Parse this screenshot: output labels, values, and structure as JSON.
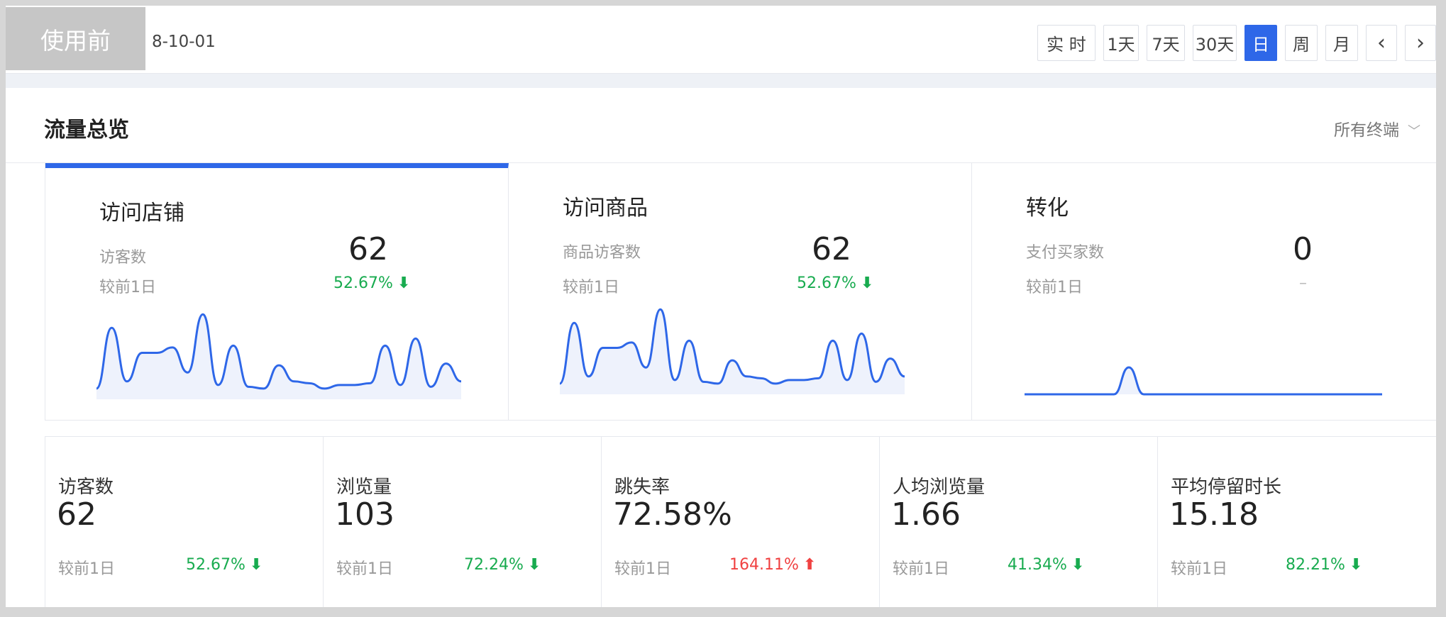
{
  "tag": "使用前",
  "date_text": "8-10-01",
  "range_buttons": [
    "实 时",
    "1天",
    "7天",
    "30天",
    "日",
    "周",
    "月",
    "‹",
    "›"
  ],
  "range_active": "日",
  "overview": {
    "title": "流量总览",
    "terminal": "所有终端"
  },
  "panels": [
    {
      "title": "访问店铺",
      "metric_label": "访客数",
      "metric_value": "62",
      "compare_label": "较前1日",
      "compare_value": "52.67%",
      "trend": "down",
      "spark": [
        12,
        80,
        20,
        52,
        52,
        58,
        30,
        95,
        16,
        60,
        14,
        12,
        38,
        20,
        18,
        12,
        16,
        16,
        18,
        60,
        16,
        68,
        14,
        40,
        20
      ]
    },
    {
      "title": "访问商品",
      "metric_label": "商品访客数",
      "metric_value": "62",
      "compare_label": "较前1日",
      "compare_value": "52.67%",
      "trend": "down",
      "spark": [
        12,
        80,
        20,
        52,
        52,
        58,
        30,
        95,
        16,
        60,
        14,
        12,
        38,
        20,
        18,
        12,
        16,
        16,
        18,
        60,
        16,
        68,
        14,
        40,
        20
      ]
    },
    {
      "title": "转化",
      "metric_label": "支付买家数",
      "metric_value": "0",
      "compare_label": "较前1日",
      "compare_value": "–",
      "trend": "none",
      "spark": [
        0,
        0,
        0,
        0,
        0,
        0,
        0,
        50,
        0,
        0,
        0,
        0,
        0,
        0,
        0,
        0,
        0,
        0,
        0,
        0,
        0,
        0,
        0,
        0,
        0
      ]
    }
  ],
  "stats": [
    {
      "label": "访客数",
      "value": "62",
      "compare_label": "较前1日",
      "compare_value": "52.67%",
      "trend": "down"
    },
    {
      "label": "浏览量",
      "value": "103",
      "compare_label": "较前1日",
      "compare_value": "72.24%",
      "trend": "down"
    },
    {
      "label": "跳失率",
      "value": "72.58%",
      "compare_label": "较前1日",
      "compare_value": "164.11%",
      "trend": "up"
    },
    {
      "label": "人均浏览量",
      "value": "1.66",
      "compare_label": "较前1日",
      "compare_value": "41.34%",
      "trend": "down"
    },
    {
      "label": "平均停留时长",
      "value": "15.18",
      "compare_label": "较前1日",
      "compare_value": "82.21%",
      "trend": "down"
    }
  ],
  "colors": {
    "accent": "#2e67e8",
    "down": "#18ab4f",
    "up": "#f04141"
  }
}
